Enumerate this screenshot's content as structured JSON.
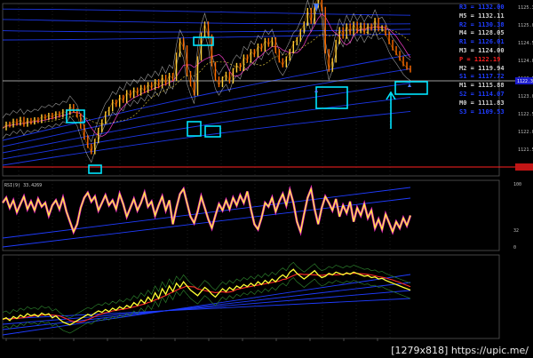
{
  "caption": "[1279x818] https://upic.me/",
  "colors": {
    "background": "#000000",
    "grid": "#3a3a3a",
    "price_line": "#ff8c00",
    "rsi_line": "#ffff33",
    "rsi_glow": "#ff2bd6",
    "channel": "#1f3cff",
    "box": "#00e5ff",
    "band": "#d8d8d8",
    "level_red": "#ff2020",
    "level_white": "#cfcfcf"
  },
  "pivots": [
    {
      "label": "R3 = 1132.00",
      "color": "#1f3cff"
    },
    {
      "label": "M5 = 1132.11",
      "color": "#cfcfcf"
    },
    {
      "label": "R2 = 1130.38",
      "color": "#1f3cff"
    },
    {
      "label": "M4 = 1128.05",
      "color": "#cfcfcf"
    },
    {
      "label": "R1 = 1126.01",
      "color": "#1f3cff"
    },
    {
      "label": "M3 = 1124.00",
      "color": "#cfcfcf"
    },
    {
      "label": "P  = 1122.19",
      "color": "#ff2020"
    },
    {
      "label": "M2 = 1119.94",
      "color": "#cfcfcf"
    },
    {
      "label": "S1 = 1117.72",
      "color": "#1f3cff"
    },
    {
      "label": "M1 = 1115.88",
      "color": "#cfcfcf"
    },
    {
      "label": "S2 = 1114.07",
      "color": "#1f3cff"
    },
    {
      "label": "M0 = 1111.83",
      "color": "#cfcfcf"
    },
    {
      "label": "S3 = 1109.53",
      "color": "#1f3cff"
    }
  ],
  "chart_data": [
    {
      "type": "line",
      "panel": "price",
      "ytick_labels": [
        "1125.35",
        "1125.00",
        "1124.50",
        "1124.00",
        "1123.50",
        "1123.00",
        "1122.50",
        "1122.00",
        "1121.50",
        "1121.00"
      ],
      "current_price_label": "1122.35",
      "x": [
        0,
        4,
        8,
        12,
        16,
        20,
        24,
        28,
        32,
        36,
        40,
        44,
        48,
        52,
        56,
        60,
        64,
        68,
        72,
        76,
        80,
        84,
        88,
        92,
        96,
        100,
        104,
        108,
        112,
        116,
        120,
        124,
        128,
        132,
        136,
        140,
        144,
        148,
        152,
        156,
        160,
        164,
        168,
        172,
        176,
        180,
        184,
        188,
        192,
        196,
        200,
        204,
        208,
        212,
        216,
        220,
        224,
        228,
        232,
        236,
        240,
        244,
        248,
        252,
        256,
        260,
        264,
        268,
        272,
        276,
        280,
        284,
        288,
        292,
        296,
        300,
        304,
        308,
        312,
        316,
        320,
        324,
        328,
        332,
        336,
        340,
        344,
        348,
        352,
        356,
        360,
        364,
        368,
        372,
        376,
        380,
        384,
        388,
        392,
        396,
        400,
        404,
        408,
        412,
        416,
        420,
        424,
        428,
        432,
        436,
        440,
        444,
        448,
        452,
        456,
        460
      ],
      "y": [
        1122.2,
        1122.32,
        1122.28,
        1122.4,
        1122.33,
        1122.45,
        1122.3,
        1122.42,
        1122.36,
        1122.44,
        1122.4,
        1122.52,
        1122.48,
        1122.56,
        1122.5,
        1122.6,
        1122.55,
        1122.66,
        1122.62,
        1122.8,
        1122.68,
        1122.55,
        1122.25,
        1121.95,
        1121.72,
        1121.55,
        1121.85,
        1122.15,
        1122.38,
        1122.6,
        1122.72,
        1122.92,
        1122.84,
        1123.05,
        1122.95,
        1123.18,
        1123.08,
        1123.25,
        1123.15,
        1123.32,
        1123.22,
        1123.4,
        1123.3,
        1123.48,
        1123.35,
        1123.6,
        1123.42,
        1123.65,
        1123.55,
        1124.2,
        1124.6,
        1124.4,
        1123.7,
        1123.4,
        1123.15,
        1124.1,
        1124.75,
        1125.05,
        1124.7,
        1123.95,
        1123.55,
        1123.38,
        1123.55,
        1123.68,
        1123.48,
        1123.78,
        1123.92,
        1123.82,
        1124.15,
        1124.05,
        1124.3,
        1124.2,
        1124.45,
        1124.35,
        1124.6,
        1124.48,
        1124.62,
        1124.3,
        1124.05,
        1123.92,
        1124.1,
        1124.3,
        1124.52,
        1124.62,
        1124.85,
        1125.05,
        1125.42,
        1125.1,
        1125.55,
        1125.8,
        1125.45,
        1124.3,
        1123.8,
        1124.05,
        1124.55,
        1124.9,
        1124.7,
        1125.0,
        1124.8,
        1125.05,
        1124.85,
        1125.02,
        1124.82,
        1125.0,
        1124.92,
        1125.15,
        1124.9,
        1124.95,
        1124.78,
        1124.55,
        1124.38,
        1124.25,
        1124.1,
        1123.95,
        1123.85,
        1123.78
      ]
    },
    {
      "type": "line",
      "panel": "oscillator",
      "title": "RSI(9) 33.4269",
      "ytick_labels": [
        "100",
        "32",
        "0"
      ],
      "x": [
        0,
        4,
        8,
        12,
        16,
        20,
        24,
        28,
        32,
        36,
        40,
        44,
        48,
        52,
        56,
        60,
        64,
        68,
        72,
        76,
        80,
        84,
        88,
        92,
        96,
        100,
        104,
        108,
        112,
        116,
        120,
        124,
        128,
        132,
        136,
        140,
        144,
        148,
        152,
        156,
        160,
        164,
        168,
        172,
        176,
        180,
        184,
        188,
        192,
        196,
        200,
        204,
        208,
        212,
        216,
        220,
        224,
        228,
        232,
        236,
        240,
        244,
        248,
        252,
        256,
        260,
        264,
        268,
        272,
        276,
        280,
        284,
        288,
        292,
        296,
        300,
        304,
        308,
        312,
        316,
        320,
        324,
        328,
        332,
        336,
        340,
        344,
        348,
        352,
        356,
        360,
        364,
        368,
        372,
        376,
        380,
        384,
        388,
        392,
        396,
        400,
        404,
        408,
        412,
        416,
        420,
        424,
        428,
        432,
        436,
        440,
        444,
        448,
        452,
        456,
        460
      ],
      "y": [
        70,
        78,
        62,
        74,
        55,
        68,
        80,
        60,
        72,
        58,
        76,
        64,
        70,
        50,
        66,
        74,
        60,
        78,
        56,
        40,
        24,
        36,
        62,
        78,
        86,
        72,
        80,
        58,
        70,
        82,
        66,
        74,
        60,
        84,
        68,
        48,
        62,
        76,
        58,
        70,
        86,
        64,
        72,
        50,
        66,
        80,
        58,
        74,
        36,
        62,
        84,
        92,
        70,
        48,
        38,
        56,
        80,
        62,
        44,
        30,
        50,
        68,
        58,
        74,
        60,
        78,
        66,
        82,
        70,
        88,
        60,
        36,
        28,
        46,
        70,
        64,
        78,
        56,
        72,
        84,
        66,
        90,
        70,
        40,
        24,
        52,
        78,
        92,
        60,
        36,
        62,
        80,
        70,
        58,
        76,
        48,
        66,
        54,
        72,
        40,
        62,
        50,
        68,
        46,
        58,
        30,
        44,
        28,
        52,
        38,
        24,
        40,
        30,
        46,
        34,
        50
      ]
    },
    {
      "type": "line",
      "panel": "indicator",
      "x": [
        0,
        4,
        8,
        12,
        16,
        20,
        24,
        28,
        32,
        36,
        40,
        44,
        48,
        52,
        56,
        60,
        64,
        68,
        72,
        76,
        80,
        84,
        88,
        92,
        96,
        100,
        104,
        108,
        112,
        116,
        120,
        124,
        128,
        132,
        136,
        140,
        144,
        148,
        152,
        156,
        160,
        164,
        168,
        172,
        176,
        180,
        184,
        188,
        192,
        196,
        200,
        204,
        208,
        212,
        216,
        220,
        224,
        228,
        232,
        236,
        240,
        244,
        248,
        252,
        256,
        260,
        264,
        268,
        272,
        276,
        280,
        284,
        288,
        292,
        296,
        300,
        304,
        308,
        312,
        316,
        320,
        324,
        328,
        332,
        336,
        340,
        344,
        348,
        352,
        356,
        360,
        364,
        368,
        372,
        376,
        380,
        384,
        388,
        392,
        396,
        400,
        404,
        408,
        412,
        416,
        420,
        424,
        428,
        432,
        436,
        440,
        444,
        448,
        452,
        456,
        460
      ],
      "y": [
        10,
        12,
        8,
        14,
        11,
        16,
        13,
        18,
        15,
        17,
        14,
        19,
        16,
        18,
        12,
        15,
        10,
        6,
        4,
        2,
        5,
        8,
        11,
        14,
        17,
        15,
        19,
        22,
        20,
        24,
        21,
        26,
        23,
        28,
        25,
        30,
        27,
        34,
        30,
        38,
        33,
        42,
        36,
        48,
        40,
        54,
        46,
        58,
        50,
        62,
        56,
        64,
        58,
        52,
        48,
        44,
        50,
        56,
        52,
        46,
        42,
        48,
        54,
        50,
        56,
        52,
        58,
        55,
        60,
        57,
        62,
        58,
        64,
        60,
        66,
        62,
        68,
        64,
        70,
        74,
        70,
        78,
        82,
        76,
        72,
        68,
        72,
        76,
        80,
        74,
        70,
        72,
        76,
        74,
        78,
        76,
        74,
        77,
        75,
        78,
        76,
        74,
        72,
        73,
        70,
        71,
        68,
        69,
        66,
        64,
        62,
        60,
        58,
        56,
        54,
        52
      ]
    }
  ]
}
